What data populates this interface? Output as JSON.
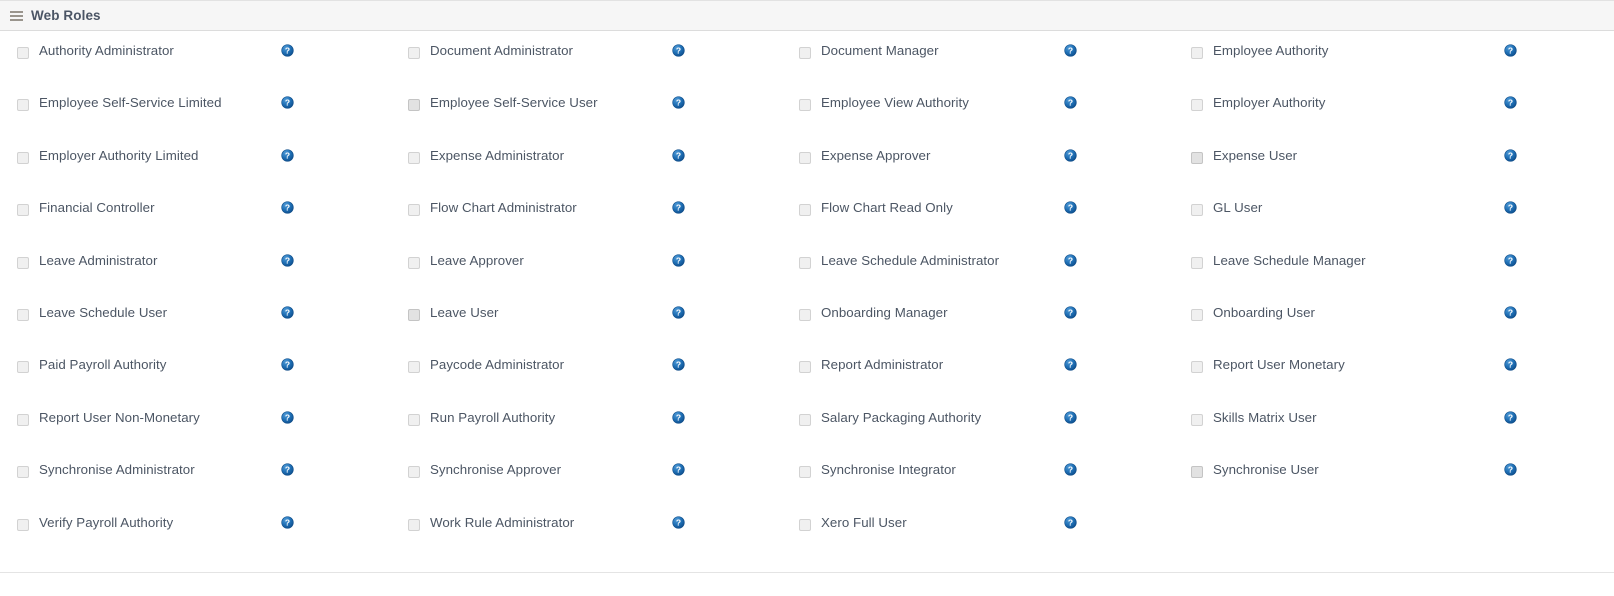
{
  "header": {
    "title": "Web Roles",
    "menu_icon": "hamburger-menu-icon"
  },
  "help_icon_name": "help-question-icon",
  "accent_color": "#1664a8",
  "label_color": "#4c5664",
  "header_bg": "#f6f6f6",
  "columns": [
    {
      "index": 1,
      "roles": [
        {
          "label": "Authority Administrator",
          "checked": false,
          "shaded": false
        },
        {
          "label": "Employee Self-Service Limited",
          "checked": false,
          "shaded": false
        },
        {
          "label": "Employer Authority Limited",
          "checked": false,
          "shaded": false
        },
        {
          "label": "Financial Controller",
          "checked": false,
          "shaded": false
        },
        {
          "label": "Leave Administrator",
          "checked": false,
          "shaded": false
        },
        {
          "label": "Leave Schedule User",
          "checked": false,
          "shaded": false
        },
        {
          "label": "Paid Payroll Authority",
          "checked": false,
          "shaded": false
        },
        {
          "label": "Report User Non-Monetary",
          "checked": false,
          "shaded": false
        },
        {
          "label": "Synchronise Administrator",
          "checked": false,
          "shaded": false
        },
        {
          "label": "Verify Payroll Authority",
          "checked": false,
          "shaded": false
        }
      ]
    },
    {
      "index": 2,
      "roles": [
        {
          "label": "Document Administrator",
          "checked": false,
          "shaded": false
        },
        {
          "label": "Employee Self-Service User",
          "checked": false,
          "shaded": true
        },
        {
          "label": "Expense Administrator",
          "checked": false,
          "shaded": false
        },
        {
          "label": "Flow Chart Administrator",
          "checked": false,
          "shaded": false
        },
        {
          "label": "Leave Approver",
          "checked": false,
          "shaded": false
        },
        {
          "label": "Leave User",
          "checked": false,
          "shaded": true
        },
        {
          "label": "Paycode Administrator",
          "checked": false,
          "shaded": false
        },
        {
          "label": "Run Payroll Authority",
          "checked": false,
          "shaded": false
        },
        {
          "label": "Synchronise Approver",
          "checked": false,
          "shaded": false
        },
        {
          "label": "Work Rule Administrator",
          "checked": false,
          "shaded": false
        }
      ]
    },
    {
      "index": 3,
      "roles": [
        {
          "label": "Document Manager",
          "checked": false,
          "shaded": false
        },
        {
          "label": "Employee View Authority",
          "checked": false,
          "shaded": false
        },
        {
          "label": "Expense Approver",
          "checked": false,
          "shaded": false
        },
        {
          "label": "Flow Chart Read Only",
          "checked": false,
          "shaded": false
        },
        {
          "label": "Leave Schedule Administrator",
          "checked": false,
          "shaded": false
        },
        {
          "label": "Onboarding Manager",
          "checked": false,
          "shaded": false
        },
        {
          "label": "Report Administrator",
          "checked": false,
          "shaded": false
        },
        {
          "label": "Salary Packaging Authority",
          "checked": false,
          "shaded": false
        },
        {
          "label": "Synchronise Integrator",
          "checked": false,
          "shaded": false
        },
        {
          "label": "Xero Full User",
          "checked": false,
          "shaded": false
        }
      ]
    },
    {
      "index": 4,
      "roles": [
        {
          "label": "Employee Authority",
          "checked": false,
          "shaded": false
        },
        {
          "label": "Employer Authority",
          "checked": false,
          "shaded": false
        },
        {
          "label": "Expense User",
          "checked": false,
          "shaded": true
        },
        {
          "label": "GL User",
          "checked": false,
          "shaded": false
        },
        {
          "label": "Leave Schedule Manager",
          "checked": false,
          "shaded": false
        },
        {
          "label": "Onboarding User",
          "checked": false,
          "shaded": false
        },
        {
          "label": "Report User Monetary",
          "checked": false,
          "shaded": false
        },
        {
          "label": "Skills Matrix User",
          "checked": false,
          "shaded": false
        },
        {
          "label": "Synchronise User",
          "checked": false,
          "shaded": true
        },
        {
          "label": "",
          "checked": false,
          "shaded": false,
          "empty": true
        }
      ]
    }
  ]
}
